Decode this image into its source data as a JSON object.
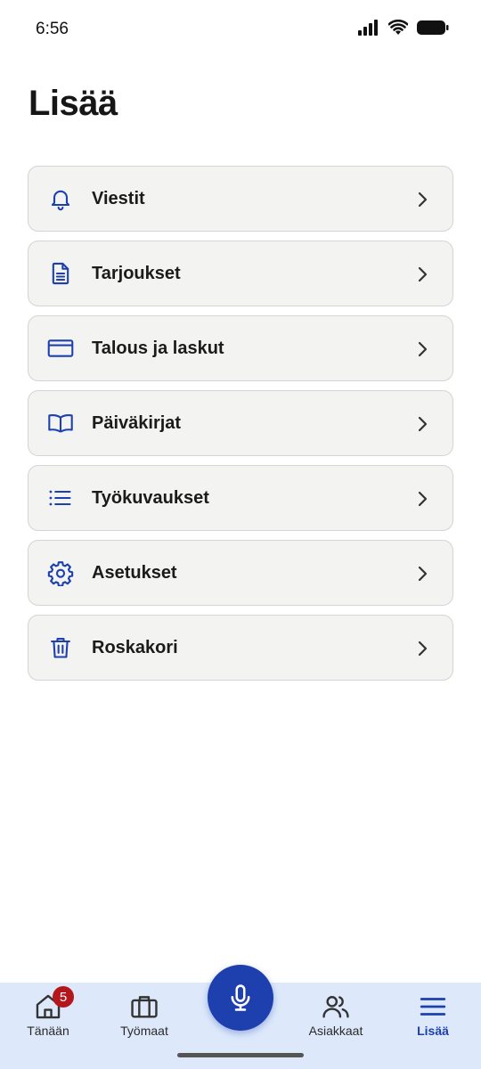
{
  "status_bar": {
    "time": "6:56"
  },
  "page_title": "Lisää",
  "menu": {
    "items": [
      {
        "label": "Viestit",
        "icon": "bell-icon"
      },
      {
        "label": "Tarjoukset",
        "icon": "document-icon"
      },
      {
        "label": "Talous ja laskut",
        "icon": "credit-card-icon"
      },
      {
        "label": "Päiväkirjat",
        "icon": "book-icon"
      },
      {
        "label": "Työkuvaukset",
        "icon": "list-icon"
      },
      {
        "label": "Asetukset",
        "icon": "gear-icon"
      },
      {
        "label": "Roskakori",
        "icon": "trash-icon"
      }
    ]
  },
  "tab_bar": {
    "tabs": [
      {
        "label": "Tänään",
        "icon": "home-icon",
        "badge": "5"
      },
      {
        "label": "Työmaat",
        "icon": "briefcase-icon"
      },
      {
        "label": "Asiakkaat",
        "icon": "users-icon"
      },
      {
        "label": "Lisää",
        "icon": "menu-icon",
        "active": true
      }
    ],
    "mic_icon": "microphone-icon"
  },
  "colors": {
    "accent": "#1e40af",
    "tab_bar_bg": "#dde9fb",
    "card_bg": "#f3f3f2",
    "badge": "#b3171b"
  }
}
